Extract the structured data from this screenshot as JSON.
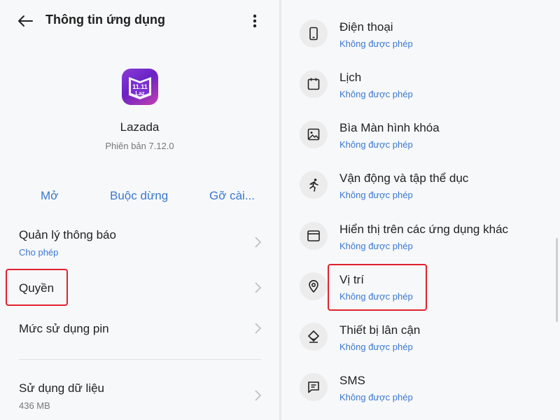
{
  "left": {
    "header": {
      "title": "Thông tin ứng dụng"
    },
    "app": {
      "name": "Lazada",
      "version": "Phiên bản 7.12.0",
      "icon_label": "Laz",
      "icon_badge": "11.11"
    },
    "actions": {
      "open": "Mở",
      "force_stop": "Buộc dừng",
      "uninstall": "Gỡ cài..."
    },
    "rows": {
      "notifications": {
        "title": "Quản lý thông báo",
        "sub": "Cho phép"
      },
      "permissions": {
        "title": "Quyền"
      },
      "battery": {
        "title": "Mức sử dụng pin"
      },
      "data_usage": {
        "title": "Sử dụng dữ liệu",
        "sub": "436 MB"
      }
    }
  },
  "right": {
    "permissions": [
      {
        "icon": "phone-icon",
        "title": "Điện thoại",
        "status": "Không được phép"
      },
      {
        "icon": "calendar-icon",
        "title": "Lịch",
        "status": "Không được phép"
      },
      {
        "icon": "image-icon",
        "title": "Bìa Màn hình khóa",
        "status": "Không được phép"
      },
      {
        "icon": "running-icon",
        "title": "Vận động và tập thể dục",
        "status": "Không được phép"
      },
      {
        "icon": "overlay-window-icon",
        "title": "Hiển thị trên các ứng dụng khác",
        "status": "Không được phép"
      },
      {
        "icon": "location-pin-icon",
        "title": "Vị trí",
        "status": "Không được phép"
      },
      {
        "icon": "nearby-devices-icon",
        "title": "Thiết bị lân cận",
        "status": "Không được phép"
      },
      {
        "icon": "sms-icon",
        "title": "SMS",
        "status": "Không được phép"
      }
    ]
  },
  "colors": {
    "accent": "#3a78d0",
    "highlight": "#e0212c",
    "muted": "#777777"
  }
}
